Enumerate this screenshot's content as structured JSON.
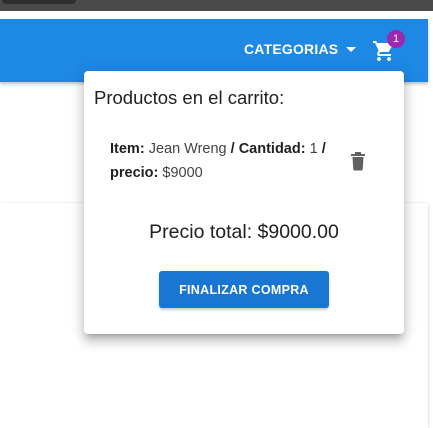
{
  "navbar": {
    "categories_label": "CATEGORIAS",
    "cart_badge_count": "1"
  },
  "cart_popover": {
    "title": "Productos en el carrito:",
    "items": [
      {
        "item_label": "Item:",
        "item_value": "Jean Wreng",
        "sep1": "/",
        "quantity_label": "Cantidad:",
        "quantity_value": "1",
        "sep2": "/",
        "price_label": "precio:",
        "price_value": "$9000"
      }
    ],
    "total_text": "Precio total: $9000.00",
    "checkout_label": "FINALIZAR COMPRA"
  },
  "colors": {
    "navbar": "#1e88e5",
    "primary_button": "#1976d2",
    "badge": "#9c27b0"
  },
  "icons": {
    "cart": "shopping-cart-icon",
    "delete": "trash-icon",
    "dropdown": "caret-down-icon"
  }
}
